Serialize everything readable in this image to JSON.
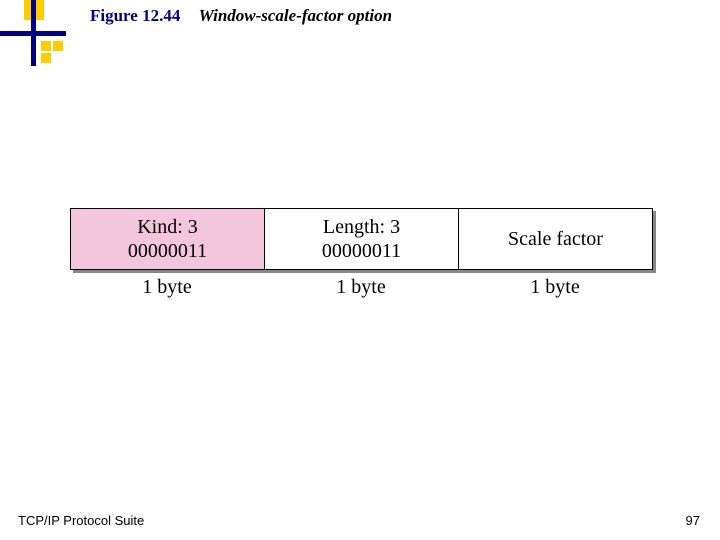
{
  "heading": {
    "figure_label": "Figure 12.44",
    "title": "Window-scale-factor option"
  },
  "cells": [
    {
      "line1": "Kind: 3",
      "line2": "00000011",
      "size": "1 byte"
    },
    {
      "line1": "Length: 3",
      "line2": "00000011",
      "size": "1 byte"
    },
    {
      "line1": "Scale factor",
      "line2": "",
      "size": "1 byte"
    }
  ],
  "footer": {
    "left": "TCP/IP Protocol Suite",
    "page": "97"
  }
}
